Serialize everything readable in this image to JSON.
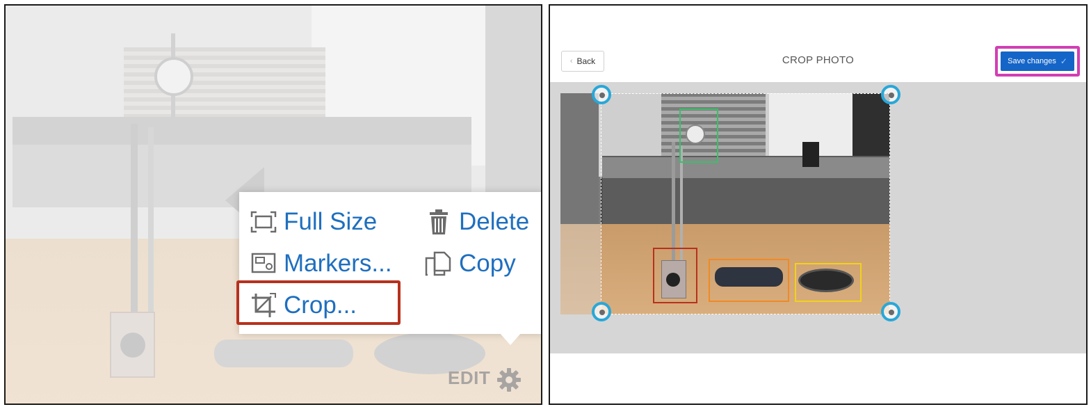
{
  "left_panel": {
    "menu": {
      "items": [
        {
          "label": "Full Size",
          "icon": "full-size-icon"
        },
        {
          "label": "Delete",
          "icon": "trash-icon"
        },
        {
          "label": "Markers...",
          "icon": "markers-icon"
        },
        {
          "label": "Copy",
          "icon": "copy-icon"
        },
        {
          "label": "Crop...",
          "icon": "crop-icon",
          "highlighted": true
        }
      ]
    },
    "edit_label": "EDIT",
    "edit_icon": "gear-icon",
    "highlight_color": "#b7311d"
  },
  "right_panel": {
    "header": {
      "back_label": "Back",
      "title": "CROP PHOTO",
      "save_label": "Save changes",
      "save_icon": "check-icon"
    },
    "colors": {
      "save_button": "#1565c8",
      "save_highlight": "#d23eb4",
      "crop_handles": "#29a7d8",
      "canvas_bg": "#d6d6d6"
    },
    "crop_handles": [
      "top-left",
      "top-right",
      "bottom-left",
      "bottom-right"
    ],
    "markers": [
      {
        "name": "marker-green",
        "color": "#3bbf6a"
      },
      {
        "name": "marker-red",
        "color": "#b7311d"
      },
      {
        "name": "marker-orange",
        "color": "#f08a24"
      },
      {
        "name": "marker-yellow",
        "color": "#f2d21b"
      }
    ]
  }
}
